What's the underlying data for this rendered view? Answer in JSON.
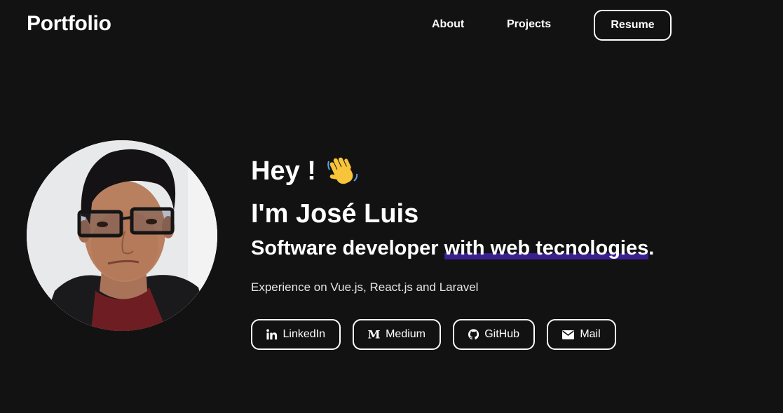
{
  "header": {
    "brand": "Portfolio",
    "nav": {
      "about": "About",
      "projects": "Projects"
    },
    "resume_label": "Resume"
  },
  "hero": {
    "greeting": "Hey !",
    "greeting_icon": "waving-hand-icon",
    "name": "I'm José Luis",
    "role_plain": "Software developer ",
    "role_highlight": "with web tecnologies",
    "role_end": ".",
    "subtitle": "Experience on Vue.js, React.js and Laravel",
    "accent_color": "#3a1f8f"
  },
  "socials": [
    {
      "label": "LinkedIn",
      "icon": "linkedin-icon"
    },
    {
      "label": "Medium",
      "icon": "medium-icon"
    },
    {
      "label": "GitHub",
      "icon": "github-icon"
    },
    {
      "label": "Mail",
      "icon": "mail-icon"
    }
  ],
  "colors": {
    "background": "#121212",
    "text": "#ffffff"
  }
}
